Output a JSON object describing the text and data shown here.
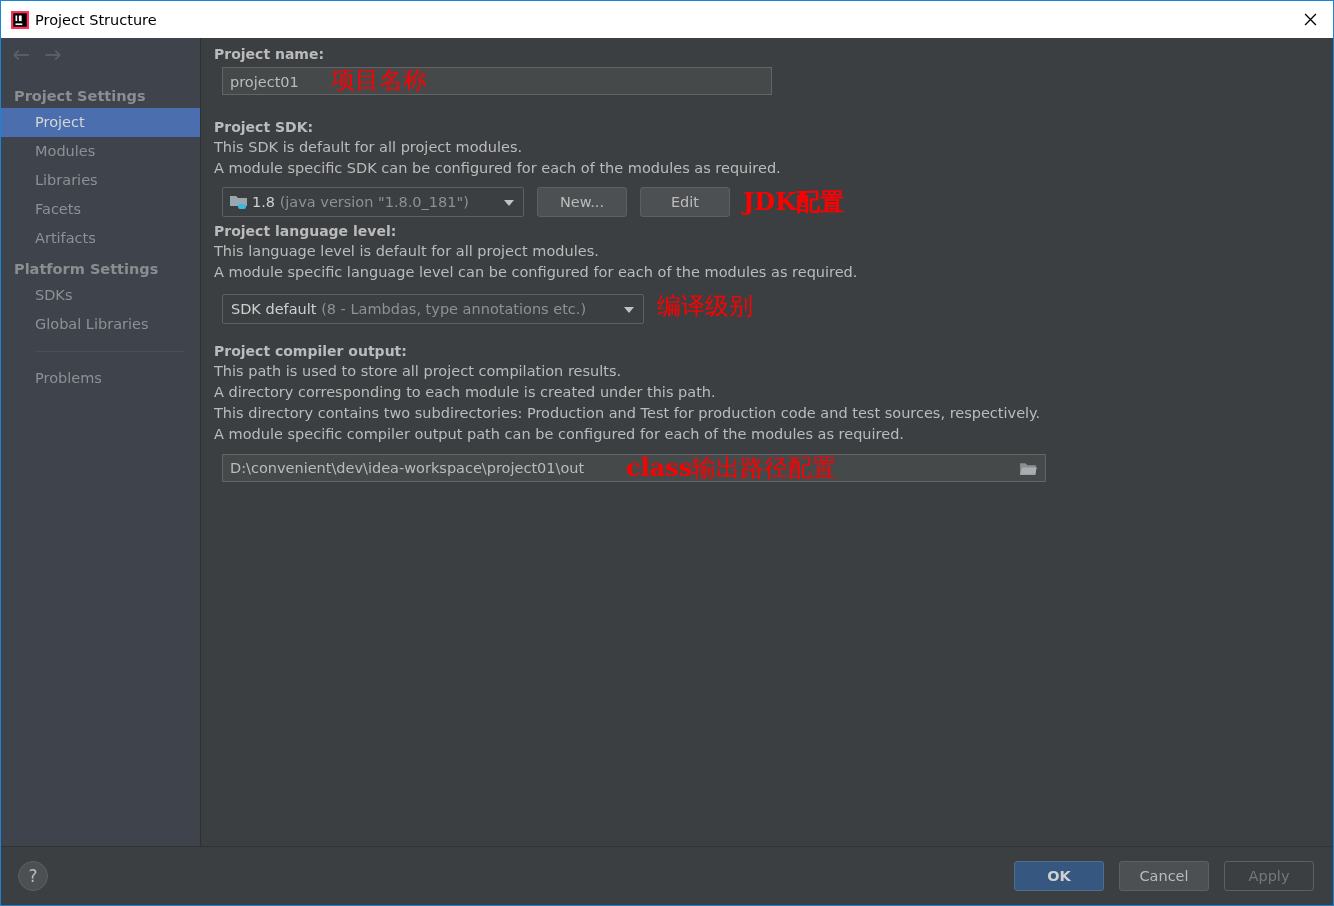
{
  "window": {
    "title": "Project Structure"
  },
  "sidebar": {
    "groups": [
      {
        "title": "Project Settings",
        "items": [
          {
            "label": "Project",
            "selected": true
          },
          {
            "label": "Modules",
            "selected": false
          },
          {
            "label": "Libraries",
            "selected": false
          },
          {
            "label": "Facets",
            "selected": false
          },
          {
            "label": "Artifacts",
            "selected": false
          }
        ]
      },
      {
        "title": "Platform Settings",
        "items": [
          {
            "label": "SDKs",
            "selected": false
          },
          {
            "label": "Global Libraries",
            "selected": false
          }
        ]
      }
    ],
    "footer_items": [
      {
        "label": "Problems",
        "selected": false
      }
    ]
  },
  "project_name": {
    "label": "Project name:",
    "value": "project01",
    "annotation": "项目名称"
  },
  "project_sdk": {
    "label": "Project SDK:",
    "description": [
      "This SDK is default for all project modules.",
      "A module specific SDK can be configured for each of the modules as required."
    ],
    "dropdown": {
      "value": "1.8",
      "detail": "(java version \"1.8.0_181\")"
    },
    "buttons": [
      {
        "label": "New..."
      },
      {
        "label": "Edit"
      }
    ],
    "annotation": "JDK配置"
  },
  "language_level": {
    "label": "Project language level:",
    "description": [
      "This language level is default for all project modules.",
      "A module specific language level can be configured for each of the modules as required."
    ],
    "dropdown": {
      "value": "SDK default",
      "detail": "(8 - Lambdas, type annotations etc.)"
    },
    "annotation": "编译级别"
  },
  "compiler_output": {
    "label": "Project compiler output:",
    "description": [
      "This path is used to store all project compilation results.",
      "A directory corresponding to each module is created under this path.",
      "This directory contains two subdirectories: Production and Test for production code and test sources, respectively.",
      "A module specific compiler output path can be configured for each of the modules as required."
    ],
    "value": "D:\\convenient\\dev\\idea-workspace\\project01\\out",
    "annotation": "**class**输出路径配置"
  },
  "footer": {
    "help": "?",
    "buttons": [
      {
        "label": "OK",
        "kind": "primary",
        "disabled": false
      },
      {
        "label": "Cancel",
        "kind": "normal",
        "disabled": false
      },
      {
        "label": "Apply",
        "kind": "normal",
        "disabled": true
      }
    ]
  }
}
